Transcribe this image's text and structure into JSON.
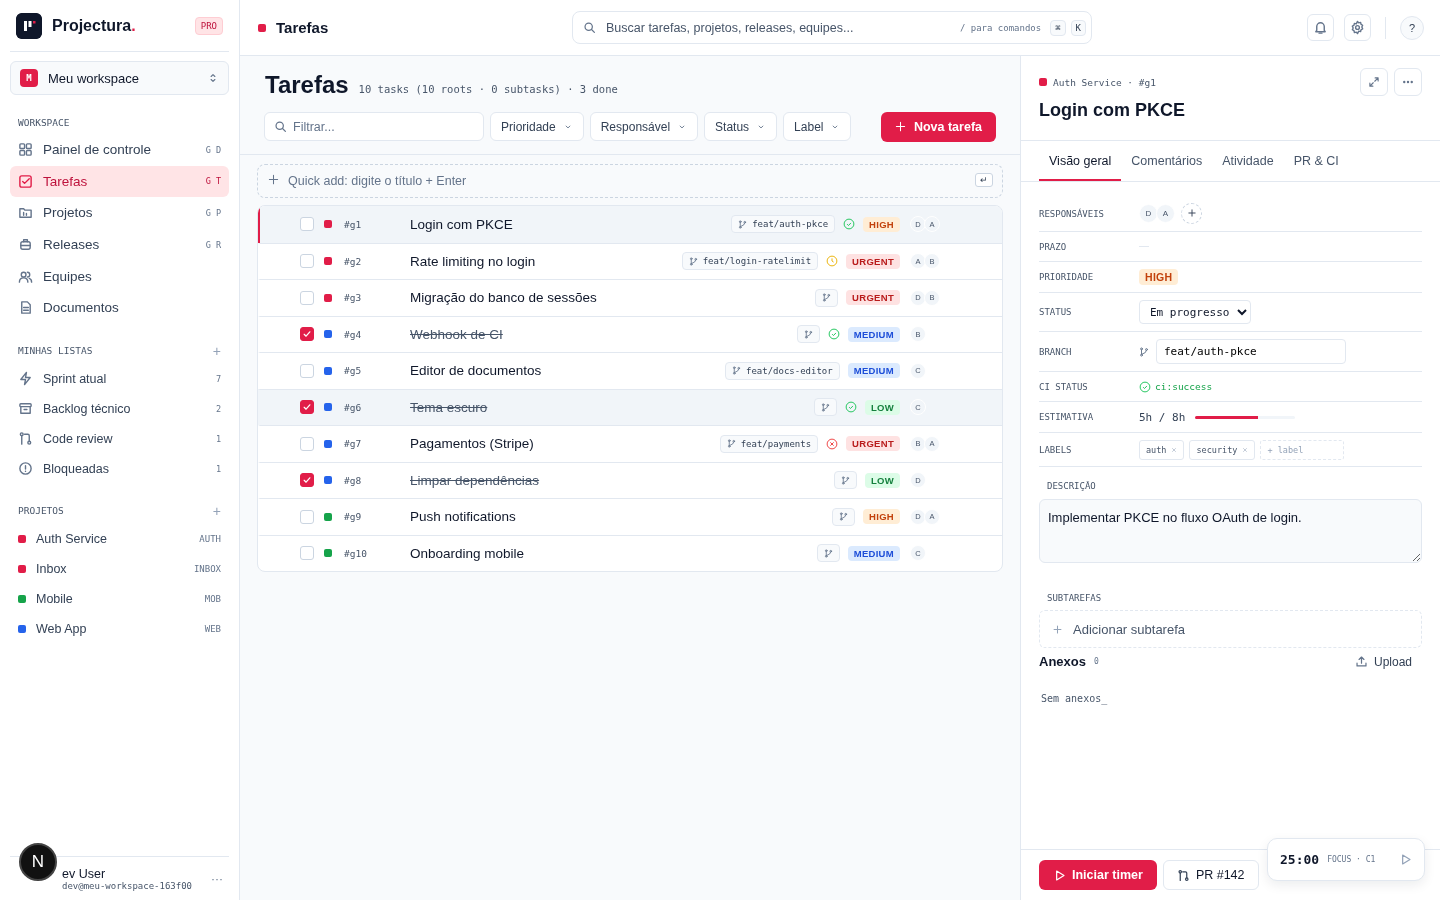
{
  "brand": {
    "name": "Projectura",
    "mark": ".",
    "plan": "PRO"
  },
  "workspace": {
    "initial": "M",
    "name": "Meu workspace"
  },
  "nav": {
    "title": "WORKSPACE",
    "items": [
      {
        "label": "Painel de controle",
        "shortcut": "G D",
        "selected": false
      },
      {
        "label": "Tarefas",
        "shortcut": "G T",
        "selected": true
      },
      {
        "label": "Projetos",
        "shortcut": "G P",
        "selected": false
      },
      {
        "label": "Releases",
        "shortcut": "G R",
        "selected": false
      },
      {
        "label": "Equipes",
        "selected": false
      },
      {
        "label": "Documentos",
        "selected": false
      }
    ]
  },
  "lists": {
    "title": "MINHAS LISTAS",
    "add": "+",
    "items": [
      {
        "label": "Sprint atual",
        "count": "7"
      },
      {
        "label": "Backlog técnico",
        "count": "2"
      },
      {
        "label": "Code review",
        "count": "1"
      },
      {
        "label": "Bloqueadas",
        "count": "1"
      }
    ]
  },
  "projects": {
    "title": "PROJETOS",
    "add": "+",
    "items": [
      {
        "label": "Auth Service",
        "code": "AUTH",
        "color": "#e11d48"
      },
      {
        "label": "Inbox",
        "code": "INBOX",
        "color": "#e11d48"
      },
      {
        "label": "Mobile",
        "code": "MOB",
        "color": "#16a34a"
      },
      {
        "label": "Web App",
        "code": "WEB",
        "color": "#2563eb"
      }
    ]
  },
  "user": {
    "name": "ev User",
    "email": "dev@meu-workspace-163f00",
    "more": "···"
  },
  "dev_badge": "N",
  "topbar": {
    "title": "Tarefas",
    "color": "#e11d48",
    "search_placeholder": "Buscar tarefas, projetos, releases, equipes...",
    "hint": "/ para comandos",
    "keys": [
      "⌘",
      "K"
    ],
    "help": "?"
  },
  "page": {
    "title": "Tarefas",
    "summary": "10 tasks (10 roots · 0 subtasks) · 3 done"
  },
  "filter": {
    "placeholder": "Filtrar...",
    "dropdowns": [
      "Prioridade",
      "Responsável",
      "Status",
      "Label"
    ],
    "new_button": "Nova tarefa"
  },
  "quick_add": {
    "placeholder": "Quick add: digite o título + Enter",
    "key": "↵"
  },
  "tasks": [
    {
      "id": "#g1",
      "title": "Login com PKCE",
      "color": "#e11d48",
      "done": false,
      "selected": true,
      "hovered": false,
      "branch": "feat/auth-pkce",
      "ci": {
        "kind": "success"
      },
      "priority": {
        "label": "HIGH",
        "kind": "high"
      },
      "assignees": [
        "D",
        "A"
      ]
    },
    {
      "id": "#g2",
      "title": "Rate limiting no login",
      "color": "#e11d48",
      "done": false,
      "selected": false,
      "hovered": false,
      "branch": "feat/login-ratelimit",
      "ci": {
        "kind": "pending"
      },
      "priority": {
        "label": "URGENT",
        "kind": "urgent"
      },
      "assignees": [
        "A",
        "B"
      ]
    },
    {
      "id": "#g3",
      "title": "Migração do banco de sessões",
      "color": "#e11d48",
      "done": false,
      "selected": false,
      "hovered": false,
      "priority": {
        "label": "URGENT",
        "kind": "urgent"
      },
      "assignees": [
        "D",
        "B"
      ]
    },
    {
      "id": "#g4",
      "title": "Webhook de CI",
      "color": "#2563eb",
      "done": true,
      "selected": false,
      "hovered": false,
      "ci": {
        "kind": "success"
      },
      "priority": {
        "label": "MEDIUM",
        "kind": "medium"
      },
      "assignees": [
        "B"
      ]
    },
    {
      "id": "#g5",
      "title": "Editor de documentos",
      "color": "#2563eb",
      "done": false,
      "selected": false,
      "hovered": false,
      "branch": "feat/docs-editor",
      "priority": {
        "label": "MEDIUM",
        "kind": "medium"
      },
      "assignees": [
        "C"
      ]
    },
    {
      "id": "#g6",
      "title": "Tema escuro",
      "color": "#2563eb",
      "done": true,
      "selected": false,
      "hovered": true,
      "ci": {
        "kind": "success"
      },
      "priority": {
        "label": "LOW",
        "kind": "low"
      },
      "assignees": [
        "C"
      ]
    },
    {
      "id": "#g7",
      "title": "Pagamentos (Stripe)",
      "color": "#2563eb",
      "done": false,
      "selected": false,
      "hovered": false,
      "branch": "feat/payments",
      "ci": {
        "kind": "failed"
      },
      "priority": {
        "label": "URGENT",
        "kind": "urgent"
      },
      "assignees": [
        "B",
        "A"
      ]
    },
    {
      "id": "#g8",
      "title": "Limpar dependências",
      "color": "#2563eb",
      "done": true,
      "selected": false,
      "hovered": false,
      "priority": {
        "label": "LOW",
        "kind": "low"
      },
      "assignees": [
        "D"
      ]
    },
    {
      "id": "#g9",
      "title": "Push notifications",
      "color": "#16a34a",
      "done": false,
      "selected": false,
      "hovered": false,
      "priority": {
        "label": "HIGH",
        "kind": "high"
      },
      "assignees": [
        "D",
        "A"
      ]
    },
    {
      "id": "#g10",
      "title": "Onboarding mobile",
      "color": "#16a34a",
      "done": false,
      "selected": false,
      "hovered": false,
      "priority": {
        "label": "MEDIUM",
        "kind": "medium"
      },
      "assignees": [
        "C"
      ]
    }
  ],
  "detail": {
    "project": {
      "label": "Auth Service",
      "color": "#e11d48"
    },
    "separator": "·",
    "id": "#g1",
    "title": "Login com PKCE",
    "tabs": [
      {
        "label": "Visão geral",
        "selected": true
      },
      {
        "label": "Comentários",
        "selected": false
      },
      {
        "label": "Atividade",
        "selected": false
      },
      {
        "label": "PR & CI",
        "selected": false
      }
    ],
    "fields": {
      "assignees_label": "RESPONSÁVEIS",
      "assignees": [
        "D",
        "A"
      ],
      "due_label": "PRAZO",
      "priority_label": "PRIORIDADE",
      "priority": {
        "label": "HIGH",
        "kind": "high"
      },
      "status_label": "STATUS",
      "status": "Em progresso",
      "branch_label": "BRANCH",
      "branch": "feat/auth-pkce",
      "ci_label": "CI STATUS",
      "ci": "ci:success",
      "estimate_label": "ESTIMATIVA",
      "estimate": "5h / 8h",
      "estimate_meter": {
        "level": 0.625
      },
      "labels_label": "LABELS",
      "labels": [
        "auth",
        "security"
      ],
      "label_placeholder": "+ label"
    },
    "description_label": "DESCRIÇÃO",
    "description": "Implementar PKCE no fluxo OAuth de login.",
    "subtasks_label": "SUBTAREFAS",
    "add_subtask": "Adicionar subtarefa",
    "attachments_label": "Anexos",
    "attachments_count": "0",
    "upload": "Upload",
    "no_attachments": "Sem anexos_",
    "footer": {
      "timer_button": "Iniciar timer",
      "pr_button": "PR #142"
    },
    "timer": {
      "time": "25:00",
      "mode": "FOCUS · C1"
    }
  }
}
